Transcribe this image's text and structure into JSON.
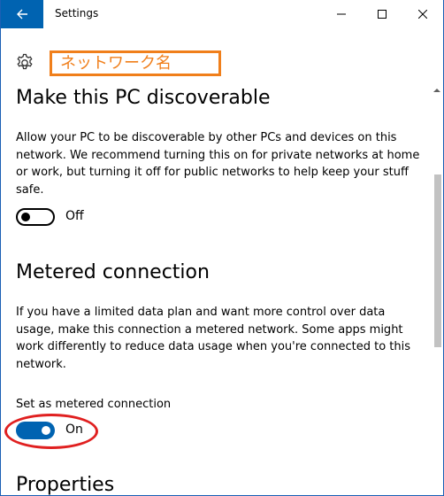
{
  "titlebar": {
    "title": "Settings",
    "accent": "#0063b1"
  },
  "header": {
    "network_name": "ネットワーク名",
    "network_name_color": "#f07f1b"
  },
  "discoverable": {
    "title": "Make this PC discoverable",
    "description": "Allow your PC to be discoverable by other PCs and devices on this network. We recommend turning this on for private networks at home or work, but turning it off for public networks to help keep your stuff safe.",
    "toggle_state": "Off"
  },
  "metered": {
    "title": "Metered connection",
    "description": "If you have a limited data plan and want more control over data usage, make this connection a metered network. Some apps might work differently to reduce data usage when you're connected to this network.",
    "setting_label": "Set as metered connection",
    "toggle_state": "On",
    "highlight_color": "#e02020"
  },
  "properties": {
    "title": "Properties"
  }
}
